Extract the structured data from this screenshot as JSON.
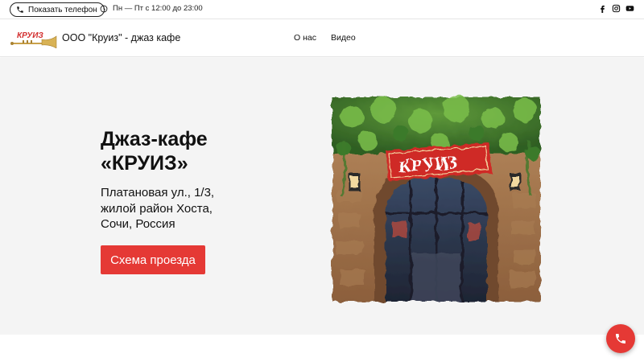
{
  "topbar": {
    "phone_button_label": "Показать телефон",
    "hours": "Пн — Пт с 12:00 до 23:00",
    "socials": [
      "facebook-icon",
      "instagram-icon",
      "youtube-icon"
    ]
  },
  "header": {
    "logo_text": "КРУИЗ",
    "company_name": "ООО \"Круиз\" - джаз кафе",
    "nav": [
      {
        "label": "О нас"
      },
      {
        "label": "Видео"
      }
    ]
  },
  "hero": {
    "title_lines": [
      "Джаз-кафе",
      "«КРУИЗ»"
    ],
    "address_lines": [
      "Платановая ул., 1/3,",
      "жилой район Хоста,",
      "Сочи, Россия"
    ],
    "cta_label": "Схема проезда",
    "photo_sign": "КРУИЗ"
  },
  "colors": {
    "accent": "#e53935",
    "hero_background": "#f4f4f4"
  }
}
